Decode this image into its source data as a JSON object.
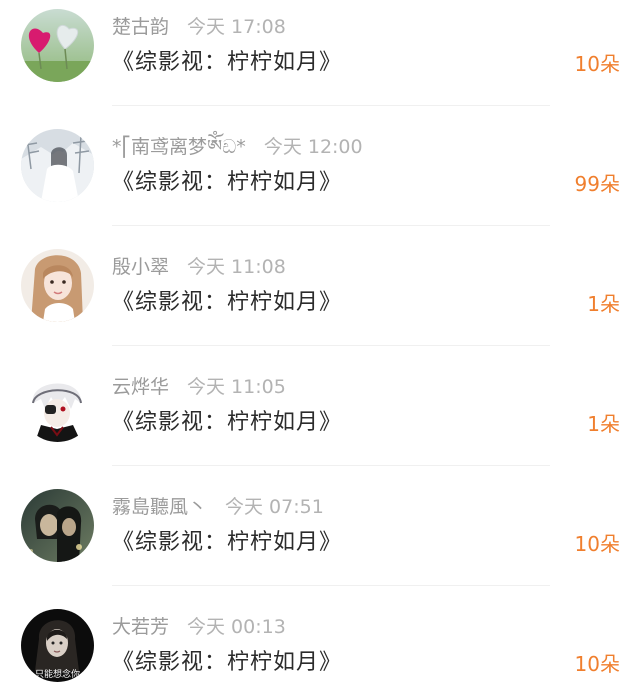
{
  "colors": {
    "amount": "#f07f2e",
    "username": "#9b9b9b",
    "timestamp": "#b3b3b3",
    "title": "#2b2b2b",
    "divider": "#f0f0f0"
  },
  "rows": [
    {
      "user": "楚古韵",
      "time": "今天 17:08",
      "title": "《综影视：柠柠如月》",
      "amount": "10朵",
      "avatar": "hearts-avatar"
    },
    {
      "user": "*⎡南鸢离梦ༀඩ*",
      "time": "今天 12:00",
      "title": "《综影视：柠柠如月》",
      "amount": "99朵",
      "avatar": "snow-scene-avatar"
    },
    {
      "user": "殷小翠",
      "time": "今天 11:08",
      "title": "《综影视：柠柠如月》",
      "amount": "1朵",
      "avatar": "girl-photo-avatar"
    },
    {
      "user": "云烨华",
      "time": "今天 11:05",
      "title": "《综影视：柠柠如月》",
      "amount": "1朵",
      "avatar": "anime-boy-avatar"
    },
    {
      "user": "霧島聽風丶",
      "time": "今天 07:51",
      "title": "《综影视：柠柠如月》",
      "amount": "10朵",
      "avatar": "couple-dark-avatar"
    },
    {
      "user": "大若芳",
      "time": "今天 00:13",
      "title": "《综影视：柠柠如月》",
      "amount": "10朵",
      "avatar": "dark-portrait-avatar",
      "avatar_text": "只能想念你"
    }
  ]
}
